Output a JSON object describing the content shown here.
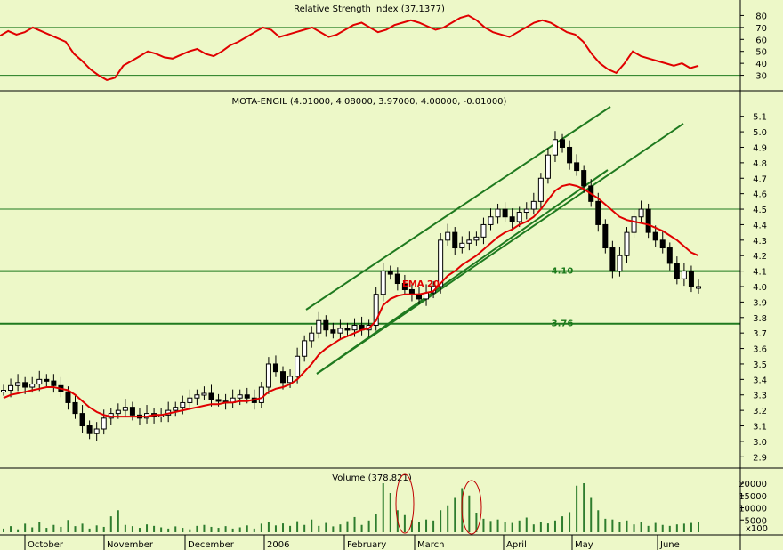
{
  "chart_data": {
    "type": "candlestick",
    "colors": {
      "background": "#EDF8C8",
      "rsi_line": "#E00000",
      "ema_line": "#E00000",
      "trendline": "#1F7A1F",
      "volume_bars": "#2E7D2E",
      "candle": "#000000",
      "highlight_ellipse": "#C00000"
    },
    "months": [
      "October",
      "November",
      "December",
      "2006",
      "February",
      "March",
      "April",
      "May",
      "June"
    ],
    "rsi_panel": {
      "title": "Relative Strength Index (37.1377)",
      "ylim": [
        20,
        90
      ],
      "ticks": [
        "80",
        "70",
        "60",
        "50",
        "40",
        "30"
      ],
      "levels": [
        70,
        30
      ],
      "values": [
        63,
        67,
        64,
        66,
        70,
        67,
        64,
        61,
        58,
        48,
        42,
        35,
        30,
        26,
        28,
        38,
        42,
        46,
        50,
        48,
        45,
        44,
        47,
        50,
        52,
        48,
        46,
        50,
        55,
        58,
        62,
        66,
        70,
        68,
        62,
        64,
        66,
        68,
        70,
        66,
        62,
        64,
        68,
        72,
        74,
        70,
        66,
        68,
        72,
        74,
        76,
        74,
        71,
        68,
        70,
        74,
        78,
        80,
        76,
        70,
        66,
        64,
        62,
        66,
        70,
        74,
        76,
        74,
        70,
        66,
        64,
        58,
        48,
        40,
        35,
        32,
        40,
        50,
        46,
        44,
        42,
        40,
        38,
        40,
        36,
        38
      ]
    },
    "price_panel": {
      "title": "MOTA-ENGIL (4.01000, 4.08000, 3.97000, 4.00000, -0.01000)",
      "ylim": [
        2.85,
        5.15
      ],
      "ticks": [
        "5.1",
        "5.0",
        "4.9",
        "4.8",
        "4.7",
        "4.6",
        "4.5",
        "4.4",
        "4.3",
        "4.2",
        "4.1",
        "4.0",
        "3.9",
        "3.8",
        "3.7",
        "3.6",
        "3.5",
        "3.4",
        "3.3",
        "3.2",
        "3.1",
        "3.0",
        "2.9"
      ],
      "levels": [
        {
          "value": 4.5,
          "label": ""
        },
        {
          "value": 4.1,
          "label": "4.10"
        },
        {
          "value": 3.76,
          "label": "3.76"
        }
      ],
      "ema_label": "EMA 20",
      "closes": [
        3.33,
        3.36,
        3.38,
        3.35,
        3.37,
        3.4,
        3.39,
        3.36,
        3.32,
        3.25,
        3.18,
        3.1,
        3.05,
        3.08,
        3.15,
        3.18,
        3.2,
        3.22,
        3.17,
        3.15,
        3.18,
        3.16,
        3.17,
        3.2,
        3.22,
        3.25,
        3.28,
        3.3,
        3.31,
        3.27,
        3.26,
        3.25,
        3.28,
        3.3,
        3.28,
        3.25,
        3.35,
        3.5,
        3.45,
        3.38,
        3.42,
        3.55,
        3.65,
        3.7,
        3.78,
        3.72,
        3.7,
        3.73,
        3.72,
        3.75,
        3.72,
        3.75,
        3.95,
        4.1,
        4.08,
        4.02,
        3.98,
        3.95,
        3.92,
        3.96,
        4.0,
        4.3,
        4.35,
        4.25,
        4.28,
        4.3,
        4.32,
        4.4,
        4.45,
        4.5,
        4.45,
        4.42,
        4.48,
        4.5,
        4.55,
        4.7,
        4.85,
        4.95,
        4.9,
        4.8,
        4.75,
        4.65,
        4.55,
        4.4,
        4.25,
        4.1,
        4.2,
        4.35,
        4.45,
        4.5,
        4.35,
        4.3,
        4.25,
        4.15,
        4.05,
        4.1,
        4.0,
        4.0
      ],
      "ema": [
        3.28,
        3.3,
        3.31,
        3.32,
        3.33,
        3.34,
        3.35,
        3.35,
        3.34,
        3.33,
        3.3,
        3.26,
        3.22,
        3.19,
        3.17,
        3.16,
        3.16,
        3.16,
        3.16,
        3.16,
        3.16,
        3.17,
        3.17,
        3.18,
        3.19,
        3.2,
        3.21,
        3.22,
        3.23,
        3.24,
        3.24,
        3.25,
        3.25,
        3.26,
        3.26,
        3.27,
        3.28,
        3.32,
        3.34,
        3.35,
        3.37,
        3.4,
        3.45,
        3.5,
        3.56,
        3.6,
        3.63,
        3.66,
        3.68,
        3.7,
        3.72,
        3.73,
        3.78,
        3.88,
        3.92,
        3.94,
        3.95,
        3.95,
        3.95,
        3.96,
        3.97,
        4.02,
        4.07,
        4.1,
        4.14,
        4.17,
        4.2,
        4.24,
        4.28,
        4.32,
        4.35,
        4.37,
        4.4,
        4.42,
        4.45,
        4.5,
        4.56,
        4.62,
        4.65,
        4.66,
        4.65,
        4.63,
        4.6,
        4.57,
        4.53,
        4.49,
        4.45,
        4.43,
        4.42,
        4.41,
        4.4,
        4.38,
        4.36,
        4.33,
        4.3,
        4.26,
        4.22,
        4.2
      ]
    },
    "volume_panel": {
      "title": "Volume (378,821)",
      "ylim": [
        0,
        24000
      ],
      "ticks": [
        "20000",
        "15000",
        "10000",
        "5000"
      ],
      "unit": "x100",
      "values": [
        1500,
        2500,
        1200,
        3500,
        2000,
        4000,
        1800,
        3000,
        2200,
        5000,
        2500,
        3500,
        1500,
        2800,
        2200,
        6500,
        9000,
        3000,
        2500,
        1800,
        3200,
        2600,
        2000,
        1500,
        2400,
        1800,
        1200,
        2600,
        3000,
        2200,
        1800,
        2500,
        1500,
        2000,
        2800,
        1500,
        3500,
        4200,
        2800,
        3600,
        2600,
        4500,
        3000,
        5200,
        2600,
        3800,
        2400,
        3200,
        4500,
        6200,
        3000,
        4800,
        7500,
        20000,
        16000,
        9000,
        7000,
        5000,
        4200,
        5200,
        4800,
        9000,
        11000,
        14000,
        18000,
        15000,
        8000,
        5500,
        4600,
        5200,
        4000,
        3800,
        4800,
        6000,
        3200,
        4200,
        3600,
        4800,
        6500,
        8200,
        19000,
        20000,
        14000,
        9000,
        5500,
        5200,
        4000,
        4800,
        3200,
        4200,
        2600,
        3800,
        3000,
        2600,
        3200,
        3500,
        3800,
        4000
      ]
    }
  }
}
